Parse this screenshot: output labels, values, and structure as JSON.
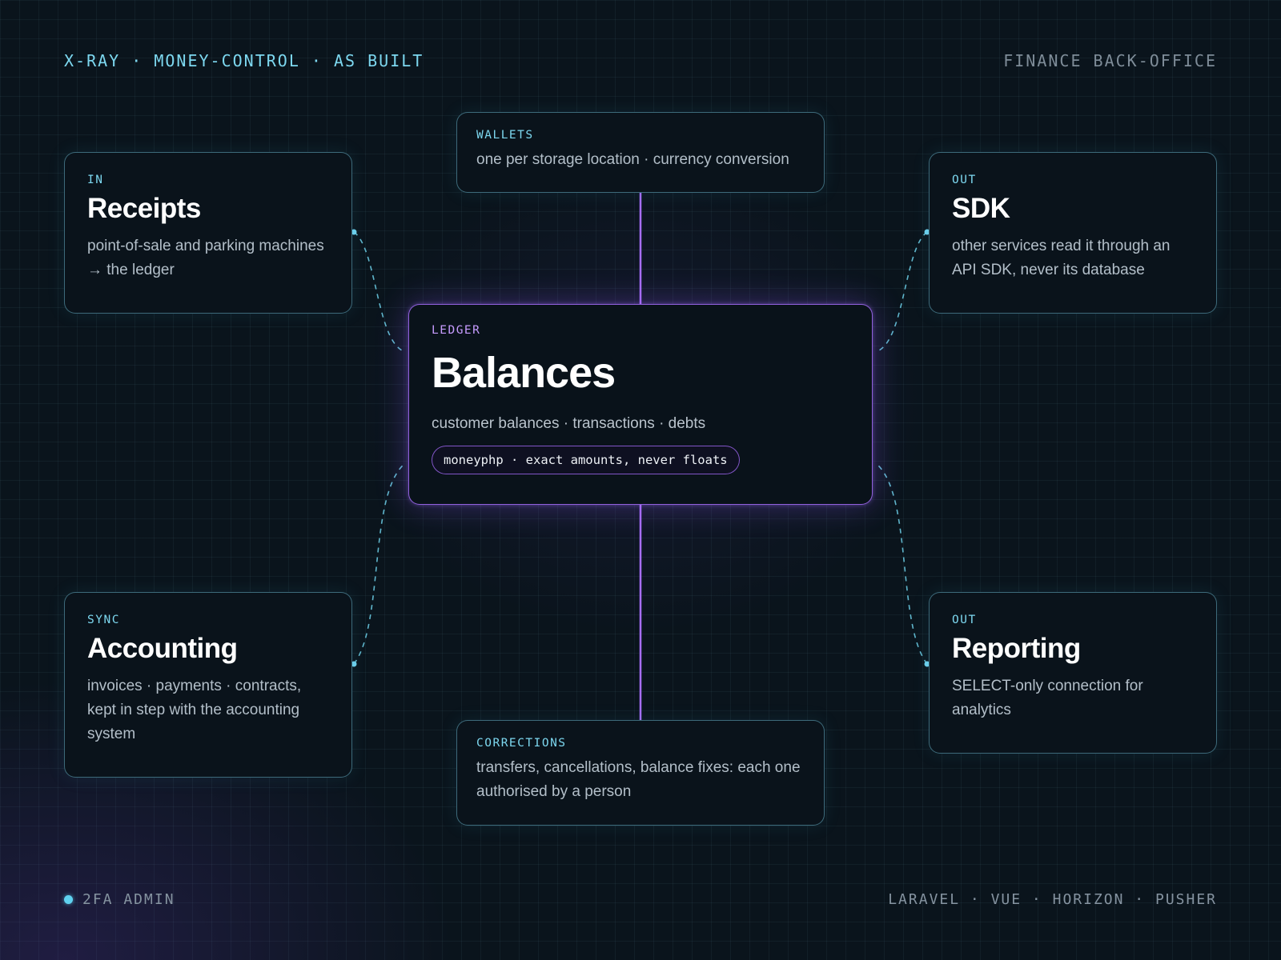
{
  "header": {
    "left": "X-RAY · MONEY-CONTROL · AS BUILT",
    "right": "FINANCE BACK-OFFICE"
  },
  "cards": {
    "receipts": {
      "kicker": "IN",
      "title": "Receipts",
      "desc": "point-of-sale and parking machines → the ledger"
    },
    "wallets": {
      "kicker": "WALLETS",
      "desc": "one per storage location · currency conversion"
    },
    "sdk": {
      "kicker": "OUT",
      "title": "SDK",
      "desc": "other services read it through an API SDK, never its database"
    },
    "ledger": {
      "kicker": "LEDGER",
      "title": "Balances",
      "desc": "customer balances · transactions · debts",
      "pill": "moneyphp · exact amounts, never floats"
    },
    "accounting": {
      "kicker": "SYNC",
      "title": "Accounting",
      "desc": "invoices · payments · contracts, kept in step with the accounting system"
    },
    "corrections": {
      "kicker": "CORRECTIONS",
      "desc": "transfers, cancellations, balance fixes: each one authorised by a person"
    },
    "reporting": {
      "kicker": "OUT",
      "title": "Reporting",
      "desc": "SELECT-only connection for analytics"
    }
  },
  "footer": {
    "left": "2FA ADMIN",
    "right": "LARAVEL · VUE · HORIZON · PUSHER"
  },
  "colors": {
    "accent_cyan": "#7dd8f0",
    "accent_purple": "#a86eff",
    "background": "#0a141c"
  }
}
